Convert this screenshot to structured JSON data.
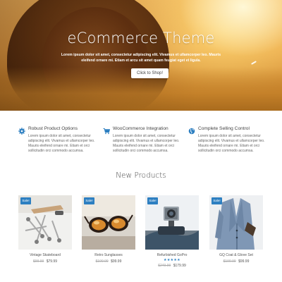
{
  "hero": {
    "title": "eCommerce Theme",
    "subtitle": "Lorem ipsum dolor sit amet, consectetur adipiscing elit. Vivamus et ullamcorper leo. Mauris eleifend ornare mi. Etiam et arcu sit amet quam feugiat eget et ligula.",
    "button_label": "Click to Shop!"
  },
  "features": [
    {
      "icon": "gear-icon",
      "title": "Robust Product Options",
      "desc": "Lorem ipsum dolor sit amet, consectetur adipiscing elit. Vivamus et ullamcorper leo. Mauris eleifend ornare mi. Etiam et orci sollicitudin orci commodo accumsa."
    },
    {
      "icon": "cart-icon",
      "title": "WooCommerce Integration",
      "desc": "Lorem ipsum dolor sit amet, consectetur adipiscing elit. Vivamus et ullamcorper leo. Mauris eleifend ornare mi. Etiam et orci sollicitudin orci commodo accumsa."
    },
    {
      "icon": "globe-icon",
      "title": "Complete Selling Control",
      "desc": "Lorem ipsum dolor sit amet, consectetur adipiscing elit. Vivamus et ullamcorper leo. Mauris eleifend ornare mi. Etiam et orci sollicitudin orci commodo accumsa."
    }
  ],
  "products_section": {
    "title": "New Products",
    "items": [
      {
        "badge": "Sale!",
        "name": "Vintage Skateboard",
        "old_price": "$99.99",
        "price": "$79.99"
      },
      {
        "badge": "Sale!",
        "name": "Retro Sunglasses",
        "old_price": "$199.99",
        "price": "$99.99"
      },
      {
        "badge": "Sale!",
        "name": "Refurbished GoPro",
        "rating_stars": "★★★★★",
        "old_price": "$249.99",
        "price": "$179.99"
      },
      {
        "badge": "Sale!",
        "name": "GQ Coat & Glove Set",
        "old_price": "$199.99",
        "price": "$99.99"
      }
    ]
  },
  "colors": {
    "accent": "#2d7fc1",
    "hero_warm": "#e8a246"
  }
}
